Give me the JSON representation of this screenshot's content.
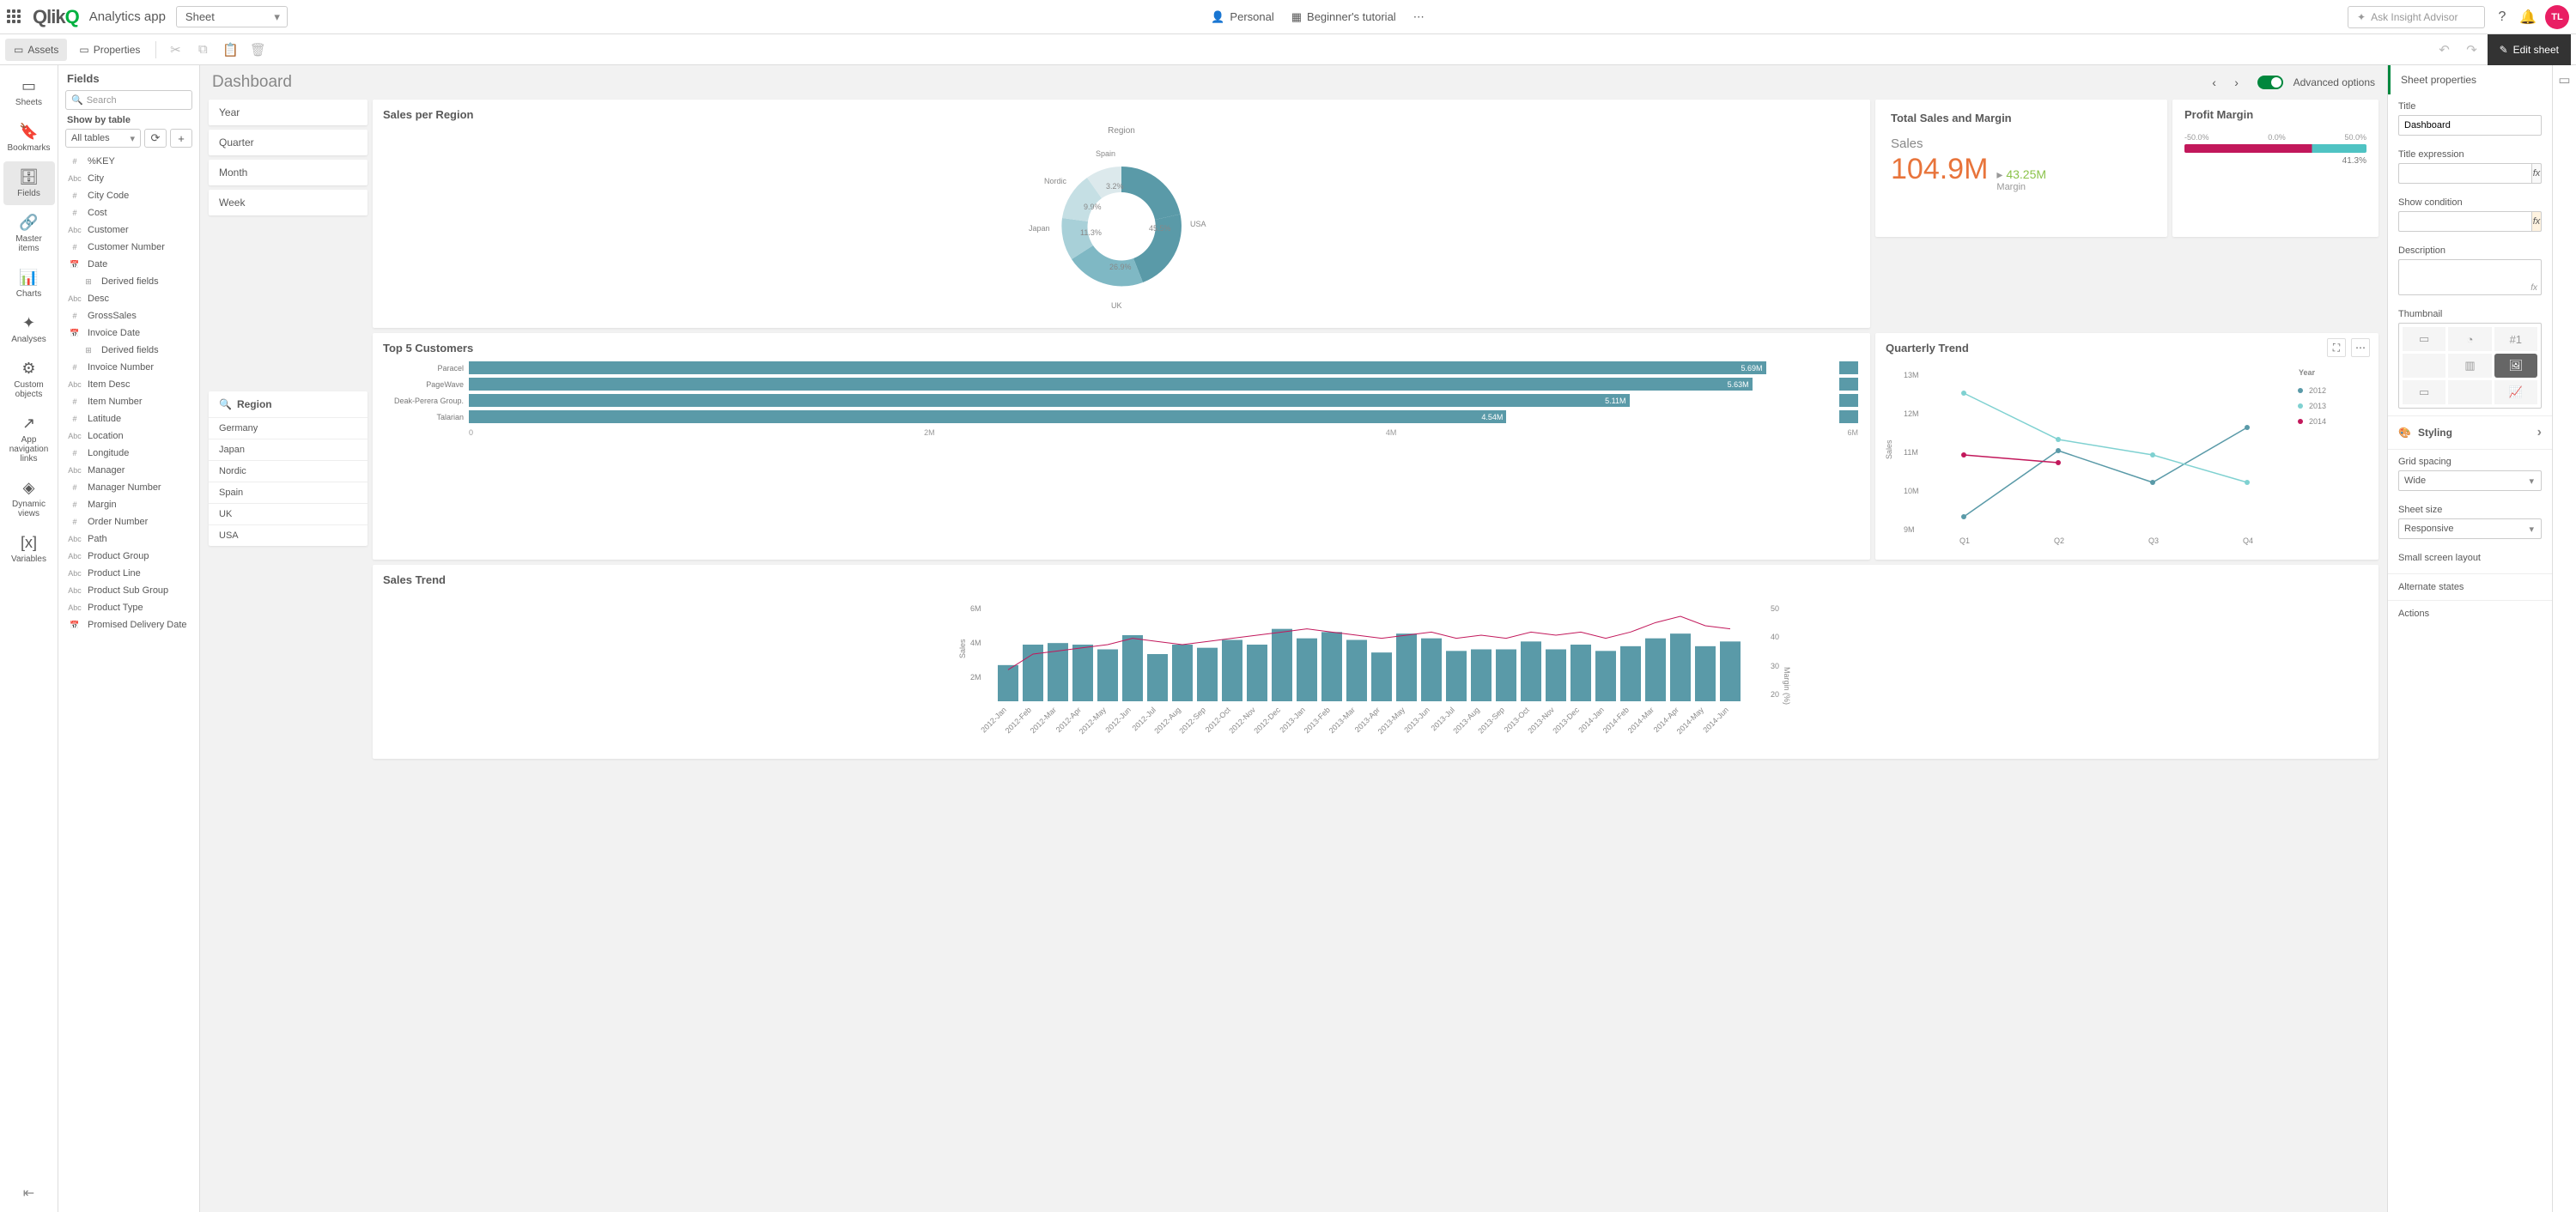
{
  "topbar": {
    "app_name": "Analytics app",
    "sheet_dd": "Sheet",
    "personal": "Personal",
    "tutorial": "Beginner's tutorial",
    "ask_placeholder": "Ask Insight Advisor",
    "avatar": "TL"
  },
  "toolbar": {
    "assets": "Assets",
    "properties": "Properties",
    "edit_sheet": "Edit sheet"
  },
  "left_rail": {
    "sheets": "Sheets",
    "bookmarks": "Bookmarks",
    "fields": "Fields",
    "master_items": "Master items",
    "charts": "Charts",
    "analyses": "Analyses",
    "custom_objects": "Custom objects",
    "app_nav": "App navigation links",
    "dynamic_views": "Dynamic views",
    "variables": "Variables"
  },
  "fields_panel": {
    "title": "Fields",
    "search_placeholder": "Search",
    "show_by": "Show by table",
    "all_tables": "All tables",
    "items": [
      {
        "type": "#",
        "name": "%KEY"
      },
      {
        "type": "Abc",
        "name": "City"
      },
      {
        "type": "#",
        "name": "City Code"
      },
      {
        "type": "#",
        "name": "Cost"
      },
      {
        "type": "Abc",
        "name": "Customer"
      },
      {
        "type": "#",
        "name": "Customer Number"
      },
      {
        "type": "📅",
        "name": "Date"
      },
      {
        "type": "⊞",
        "name": "Derived fields",
        "indent": true
      },
      {
        "type": "Abc",
        "name": "Desc"
      },
      {
        "type": "#",
        "name": "GrossSales"
      },
      {
        "type": "📅",
        "name": "Invoice Date"
      },
      {
        "type": "⊞",
        "name": "Derived fields",
        "indent": true
      },
      {
        "type": "#",
        "name": "Invoice Number"
      },
      {
        "type": "Abc",
        "name": "Item Desc"
      },
      {
        "type": "#",
        "name": "Item Number"
      },
      {
        "type": "#",
        "name": "Latitude"
      },
      {
        "type": "Abc",
        "name": "Location"
      },
      {
        "type": "#",
        "name": "Longitude"
      },
      {
        "type": "Abc",
        "name": "Manager"
      },
      {
        "type": "#",
        "name": "Manager Number"
      },
      {
        "type": "#",
        "name": "Margin"
      },
      {
        "type": "#",
        "name": "Order Number"
      },
      {
        "type": "Abc",
        "name": "Path"
      },
      {
        "type": "Abc",
        "name": "Product Group"
      },
      {
        "type": "Abc",
        "name": "Product Line"
      },
      {
        "type": "Abc",
        "name": "Product Sub Group"
      },
      {
        "type": "Abc",
        "name": "Product Type"
      },
      {
        "type": "📅",
        "name": "Promised Delivery Date"
      }
    ]
  },
  "canvas": {
    "title": "Dashboard",
    "adv_options": "Advanced options",
    "filters": [
      "Year",
      "Quarter",
      "Month",
      "Week"
    ],
    "region": {
      "title": "Region",
      "items": [
        "Germany",
        "Japan",
        "Nordic",
        "Spain",
        "UK",
        "USA"
      ]
    },
    "sales_per_region": {
      "title": "Sales per Region",
      "center_label": "Region"
    },
    "kpi": {
      "title": "Total Sales and Margin",
      "label": "Sales",
      "value": "104.9M",
      "sub": "43.25M",
      "sub_label": "Margin"
    },
    "profit_margin": {
      "title": "Profit Margin",
      "left": "-50.0%",
      "mid": "0.0%",
      "right": "50.0%",
      "value": "41.3%"
    },
    "quarterly": {
      "title": "Quarterly Trend",
      "legend_title": "Year"
    },
    "top5": {
      "title": "Top 5 Customers"
    },
    "sales_trend": {
      "title": "Sales Trend"
    }
  },
  "chart_data": {
    "sales_per_region": {
      "type": "pie",
      "title": "Sales per Region",
      "slices": [
        {
          "label": "USA",
          "value": 45.5,
          "color": "#5a9aa8"
        },
        {
          "label": "UK",
          "value": 26.9,
          "color": "#7fb8c4"
        },
        {
          "label": "Japan",
          "value": 11.3,
          "color": "#a8d0d8"
        },
        {
          "label": "Nordic",
          "value": 9.9,
          "color": "#c5dfe4"
        },
        {
          "label": "Spain",
          "value": 3.2,
          "color": "#dce9ec"
        }
      ]
    },
    "top5_customers": {
      "type": "bar",
      "orientation": "horizontal",
      "categories": [
        "Paracel",
        "PageWave",
        "Deak-Perera Group.",
        "Talarian"
      ],
      "values": [
        5.69,
        5.63,
        5.11,
        4.54
      ],
      "value_labels": [
        "5.69M",
        "5.63M",
        "5.11M",
        "4.54M"
      ],
      "xlim": [
        0,
        6
      ],
      "xticks": [
        "0",
        "2M",
        "4M",
        "6M"
      ]
    },
    "quarterly_trend": {
      "type": "line",
      "x": [
        "Q1",
        "Q2",
        "Q3",
        "Q4"
      ],
      "series": [
        {
          "name": "2012",
          "color": "#5a9aa8",
          "values": [
            9.4,
            11.1,
            10.3,
            11.7
          ]
        },
        {
          "name": "2013",
          "color": "#7fd1d1",
          "values": [
            12.6,
            11.4,
            11.0,
            10.3
          ]
        },
        {
          "name": "2014",
          "color": "#c2185b",
          "values": [
            11.0,
            10.8,
            null,
            null
          ]
        }
      ],
      "ylabel": "Sales",
      "ylim": [
        9,
        13
      ],
      "yticks": [
        "9M",
        "10M",
        "11M",
        "12M",
        "13M"
      ]
    },
    "sales_trend": {
      "type": "bar",
      "categories": [
        "2012-Jan",
        "2012-Feb",
        "2012-Mar",
        "2012-Apr",
        "2012-May",
        "2012-Jun",
        "2012-Jul",
        "2012-Aug",
        "2012-Sep",
        "2012-Oct",
        "2012-Nov",
        "2012-Dec",
        "2013-Jan",
        "2013-Feb",
        "2013-Mar",
        "2013-Apr",
        "2013-May",
        "2013-Jun",
        "2013-Jul",
        "2013-Aug",
        "2013-Sep",
        "2013-Oct",
        "2013-Nov",
        "2013-Dec",
        "2014-Jan",
        "2014-Feb",
        "2014-Mar",
        "2014-Apr",
        "2014-May",
        "2014-Jun"
      ],
      "values": [
        2.3,
        3.6,
        3.7,
        3.6,
        3.3,
        4.2,
        3.0,
        3.6,
        3.4,
        3.9,
        3.6,
        4.6,
        4.0,
        4.4,
        3.9,
        3.1,
        4.3,
        4.0,
        3.2,
        3.3,
        3.3,
        3.8,
        3.3,
        3.6,
        3.2,
        3.5,
        4.0,
        4.3,
        3.5,
        3.8
      ],
      "line_overlay": {
        "name": "Margin (%)",
        "values": [
          30,
          35,
          36,
          37,
          38,
          40,
          39,
          38,
          39,
          40,
          41,
          42,
          43,
          42,
          41,
          40,
          41,
          42,
          40,
          41,
          40,
          42,
          41,
          42,
          40,
          42,
          45,
          47,
          44,
          43
        ]
      },
      "ylabel": "Sales",
      "ylim": [
        0,
        6
      ],
      "yticks": [
        "2M",
        "4M",
        "6M"
      ],
      "y2label": "Margin (%)",
      "y2lim": [
        20,
        50
      ],
      "y2ticks": [
        "20",
        "30",
        "40",
        "50"
      ]
    },
    "profit_margin": {
      "type": "gauge",
      "value": 41.3,
      "range": [
        -50,
        50
      ]
    }
  },
  "props": {
    "header": "Sheet properties",
    "title_label": "Title",
    "title_value": "Dashboard",
    "title_expr": "Title expression",
    "show_cond": "Show condition",
    "description": "Description",
    "thumbnail": "Thumbnail",
    "thumb_num": "#1",
    "styling": "Styling",
    "grid_spacing": "Grid spacing",
    "grid_spacing_val": "Wide",
    "sheet_size": "Sheet size",
    "sheet_size_val": "Responsive",
    "small_screen": "Small screen layout",
    "alternate": "Alternate states",
    "actions": "Actions"
  }
}
